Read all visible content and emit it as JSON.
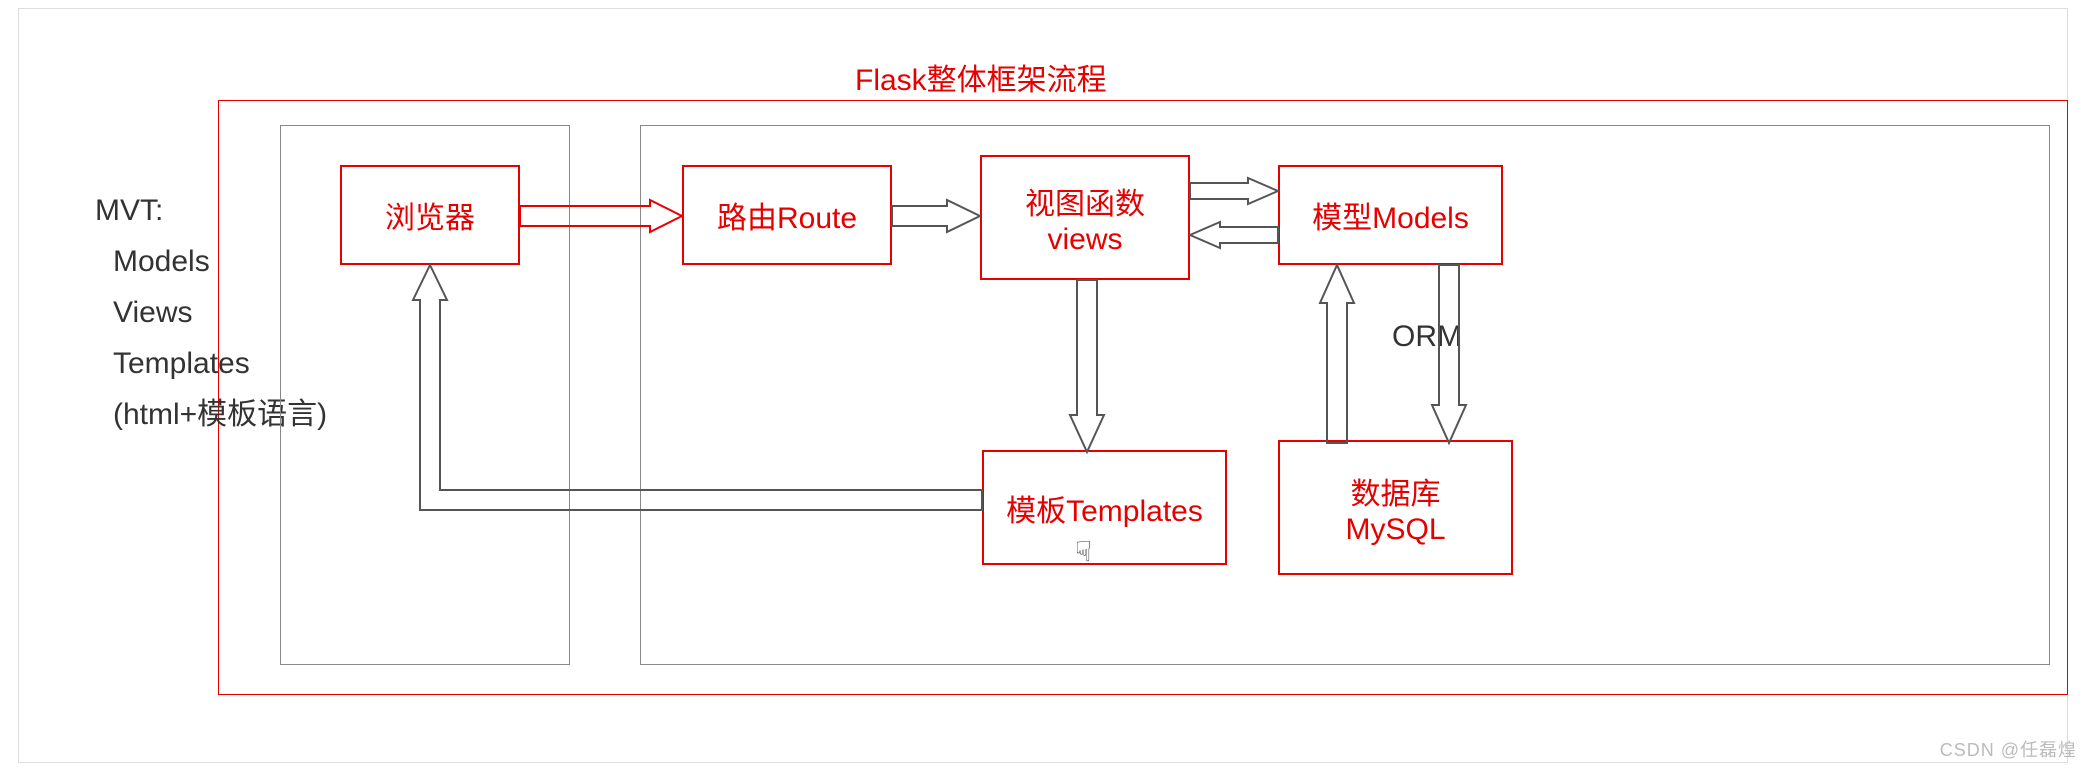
{
  "title": "Flask整体框架流程",
  "mvt": {
    "heading": "MVT:",
    "line1": "Models",
    "line2": "Views",
    "line3": "Templates",
    "line4": "(html+模板语言)"
  },
  "boxes": {
    "browser": "浏览器",
    "route": "路由Route",
    "views_line1": "视图函数",
    "views_line2": "views",
    "models": "模型Models",
    "templates": "模板Templates",
    "db_line1": "数据库",
    "db_line2": "MySQL"
  },
  "labels": {
    "orm": "ORM"
  },
  "watermark": "CSDN @任磊煌"
}
